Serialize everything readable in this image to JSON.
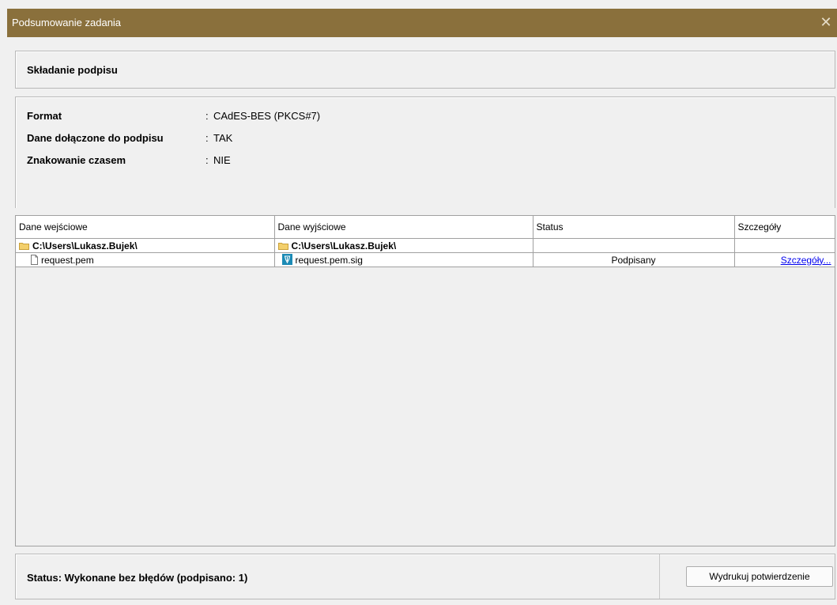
{
  "window": {
    "title": "Podsumowanie zadania",
    "close_glyph": "✕"
  },
  "operation": {
    "heading": "Składanie podpisu"
  },
  "info": {
    "separator": ":",
    "rows": [
      {
        "label": "Format",
        "value": "CAdES-BES (PKCS#7)"
      },
      {
        "label": "Dane dołączone do podpisu",
        "value": "TAK"
      },
      {
        "label": "Znakowanie czasem",
        "value": "NIE"
      }
    ]
  },
  "table": {
    "columns": [
      "Dane wejściowe",
      "Dane wyjściowe",
      "Status",
      "Szczegóły"
    ],
    "folder_row": {
      "input": "C:\\Users\\Lukasz.Bujek\\",
      "output": "C:\\Users\\Lukasz.Bujek\\"
    },
    "file_row": {
      "input": "request.pem",
      "output": "request.pem.sig",
      "status": "Podpisany",
      "details": "Szczegóły..."
    }
  },
  "footer": {
    "status": "Status: Wykonane bez błędów (podpisano: 1)",
    "print_button": "Wydrukuj potwierdzenie"
  },
  "icons": {
    "folder": "folder-icon",
    "file": "file-icon",
    "signature": "signature-file-icon",
    "close": "close-icon"
  },
  "colors": {
    "titlebar": "#8a703c",
    "link": "#0000ee",
    "signature_icon": "#1b8ab5",
    "folder_icon": "#f3cf6b"
  }
}
